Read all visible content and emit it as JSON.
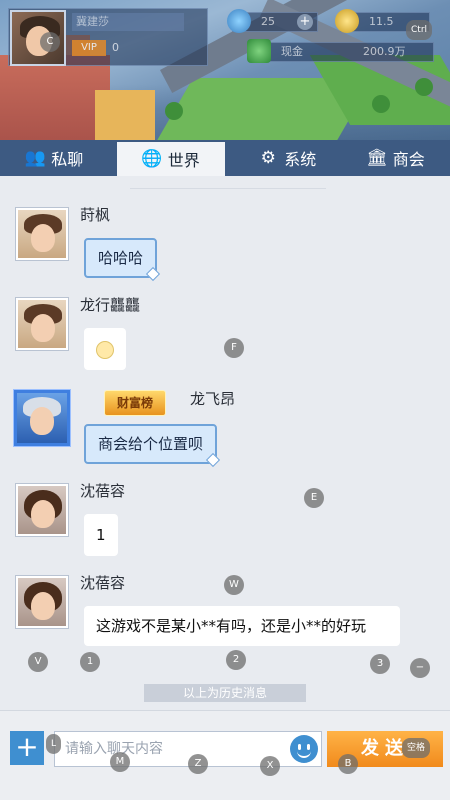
{
  "top": {
    "player_name": "冀建莎",
    "vip_label": "VIP",
    "level": "0",
    "energy": "25",
    "gold": "11.5",
    "cash_label": "现金",
    "cash_value": "200.9万"
  },
  "tabs": [
    {
      "label": "私聊",
      "icon": "user-group-icon"
    },
    {
      "label": "世界",
      "icon": "globe-icon"
    },
    {
      "label": "系统",
      "icon": "gear-icon"
    },
    {
      "label": "商会",
      "icon": "guild-icon"
    }
  ],
  "active_tab": "世界",
  "messages": [
    {
      "name": "莳枫",
      "text": "哈哈哈",
      "style": "blue"
    },
    {
      "name": "龙行龘龘",
      "text": "",
      "style": "emoji"
    },
    {
      "name": "龙飞昂",
      "badge": "财富榜",
      "text": "商会给个位置呗",
      "style": "blue"
    },
    {
      "name": "沈蓓容",
      "text": "1",
      "style": "plain"
    },
    {
      "name": "沈蓓容",
      "text": "这游戏不是某小**有吗，还是小**的好玩",
      "style": "plain"
    }
  ],
  "history_label": "以上为历史消息",
  "input": {
    "placeholder": "请输入聊天内容",
    "send_label": "发送"
  },
  "hints": {
    "c": "C",
    "ctrl": "Ctrl",
    "f": "F",
    "e": "E",
    "w": "W",
    "v": "V",
    "k1": "1",
    "k2": "2",
    "k3": "3",
    "minus": "−",
    "m": "M",
    "z": "Z",
    "x": "X",
    "b": "B",
    "space": "空格",
    "l": "L"
  }
}
